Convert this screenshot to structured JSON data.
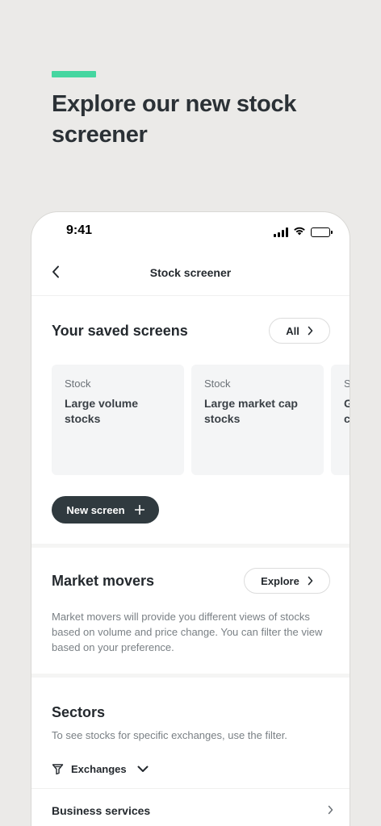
{
  "promo": {
    "title": "Explore our new stock screener",
    "accent_color": "#45d6a0"
  },
  "status_bar": {
    "time": "9:41",
    "icons": [
      "signal-icon",
      "wifi-icon",
      "battery-icon"
    ]
  },
  "nav": {
    "back_icon": "chevron-left-icon",
    "title": "Stock screener"
  },
  "saved_screens": {
    "title": "Your saved screens",
    "all_label": "All",
    "cards": [
      {
        "kicker": "Stock",
        "title": "Large volume stocks"
      },
      {
        "kicker": "Stock",
        "title": "Large market cap stocks"
      },
      {
        "kicker": "S",
        "title": "G c"
      }
    ],
    "new_screen_label": "New screen"
  },
  "market_movers": {
    "title": "Market movers",
    "explore_label": "Explore",
    "description": "Market movers will provide you different views of stocks based on volume and price change. You can filter the view based on your preference."
  },
  "sectors": {
    "title": "Sectors",
    "description": "To see stocks for specific exchanges, use the filter.",
    "filter_label": "Exchanges",
    "items": [
      {
        "label": "Business services"
      }
    ]
  },
  "colors": {
    "background": "#ebeae8",
    "primary_button": "#303a3f",
    "card": "#f4f5f6"
  }
}
